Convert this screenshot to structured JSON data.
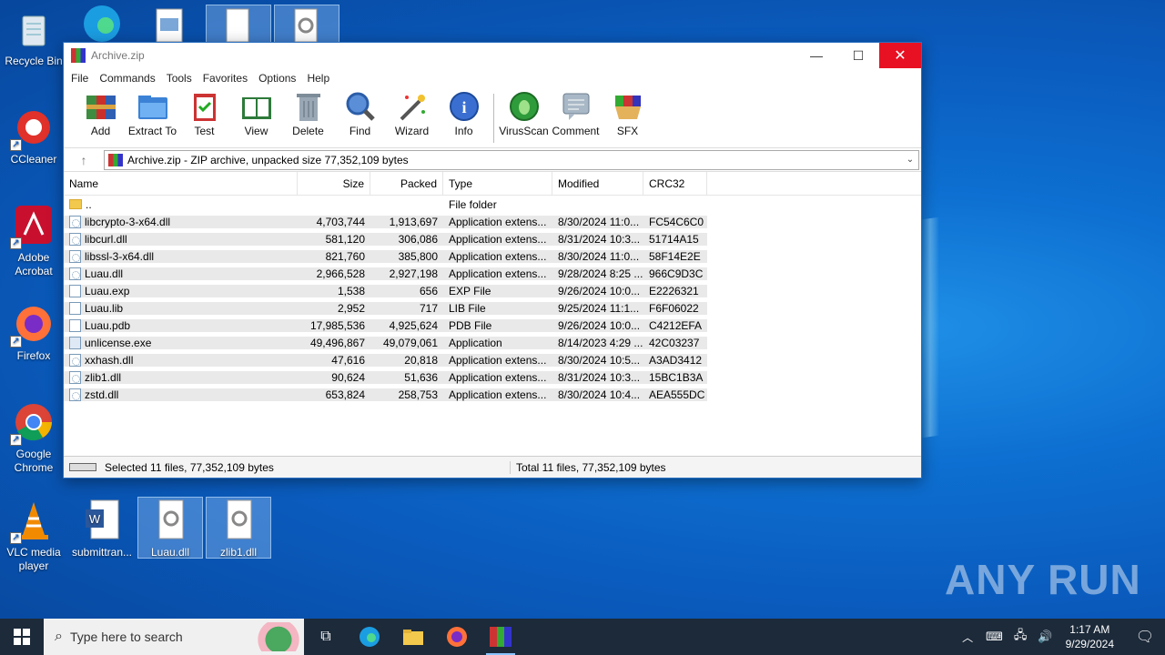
{
  "desktop": {
    "icons": [
      {
        "label": "Recycle Bin"
      },
      {
        "label": "CCleaner"
      },
      {
        "label": "Adobe Acrobat"
      },
      {
        "label": "Firefox"
      },
      {
        "label": "Google Chrome"
      },
      {
        "label": "VLC media player"
      },
      {
        "label": "submittran..."
      },
      {
        "label": "Luau.dll"
      },
      {
        "label": "zlib1.dll"
      }
    ],
    "watermark": "ANY RUN"
  },
  "window": {
    "title": "Archive.zip",
    "menu": [
      "File",
      "Commands",
      "Tools",
      "Favorites",
      "Options",
      "Help"
    ],
    "toolbar": [
      "Add",
      "Extract To",
      "Test",
      "View",
      "Delete",
      "Find",
      "Wizard",
      "Info",
      "VirusScan",
      "Comment",
      "SFX"
    ],
    "address": "Archive.zip - ZIP archive, unpacked size 77,352,109 bytes",
    "columns": [
      "Name",
      "Size",
      "Packed",
      "Type",
      "Modified",
      "CRC32"
    ],
    "parent_row": {
      "name": "..",
      "type": "File folder"
    },
    "files": [
      {
        "name": "libcrypto-3-x64.dll",
        "size": "4,703,744",
        "packed": "1,913,697",
        "type": "Application extens...",
        "modified": "8/30/2024 11:0...",
        "crc": "FC54C6C0"
      },
      {
        "name": "libcurl.dll",
        "size": "581,120",
        "packed": "306,086",
        "type": "Application extens...",
        "modified": "8/31/2024 10:3...",
        "crc": "51714A15"
      },
      {
        "name": "libssl-3-x64.dll",
        "size": "821,760",
        "packed": "385,800",
        "type": "Application extens...",
        "modified": "8/30/2024 11:0...",
        "crc": "58F14E2E"
      },
      {
        "name": "Luau.dll",
        "size": "2,966,528",
        "packed": "2,927,198",
        "type": "Application extens...",
        "modified": "9/28/2024 8:25 ...",
        "crc": "966C9D3C"
      },
      {
        "name": "Luau.exp",
        "size": "1,538",
        "packed": "656",
        "type": "EXP File",
        "modified": "9/26/2024 10:0...",
        "crc": "E2226321"
      },
      {
        "name": "Luau.lib",
        "size": "2,952",
        "packed": "717",
        "type": "LIB File",
        "modified": "9/25/2024 11:1...",
        "crc": "F6F06022"
      },
      {
        "name": "Luau.pdb",
        "size": "17,985,536",
        "packed": "4,925,624",
        "type": "PDB File",
        "modified": "9/26/2024 10:0...",
        "crc": "C4212EFA"
      },
      {
        "name": "unlicense.exe",
        "size": "49,496,867",
        "packed": "49,079,061",
        "type": "Application",
        "modified": "8/14/2023 4:29 ...",
        "crc": "42C03237"
      },
      {
        "name": "xxhash.dll",
        "size": "47,616",
        "packed": "20,818",
        "type": "Application extens...",
        "modified": "8/30/2024 10:5...",
        "crc": "A3AD3412"
      },
      {
        "name": "zlib1.dll",
        "size": "90,624",
        "packed": "51,636",
        "type": "Application extens...",
        "modified": "8/31/2024 10:3...",
        "crc": "15BC1B3A"
      },
      {
        "name": "zstd.dll",
        "size": "653,824",
        "packed": "258,753",
        "type": "Application extens...",
        "modified": "8/30/2024 10:4...",
        "crc": "AEA555DC"
      }
    ],
    "status_selected": "Selected 11 files, 77,352,109 bytes",
    "status_total": "Total 11 files, 77,352,109 bytes"
  },
  "taskbar": {
    "search_placeholder": "Type here to search",
    "time": "1:17 AM",
    "date": "9/29/2024"
  }
}
